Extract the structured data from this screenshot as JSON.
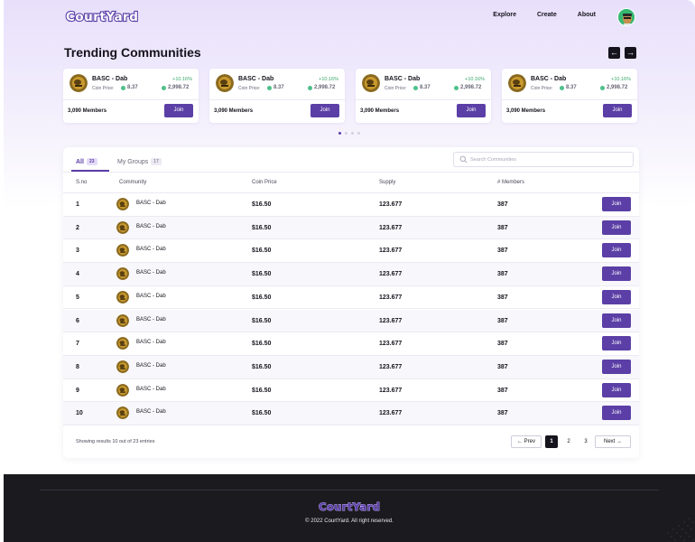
{
  "brand": {
    "logo_text": "CourtYard",
    "accent": "#5b3fa6"
  },
  "nav": {
    "links": [
      "Explore",
      "Create",
      "About"
    ]
  },
  "trending": {
    "title": "Trending Communities",
    "prev_icon": "←",
    "next_icon": "→",
    "cards": [
      {
        "name": "BASC - Dab",
        "change": "+10.16%",
        "price_label": "Coin Price:",
        "price": "8.37",
        "supply": "2,998.72",
        "members": "3,090 Members",
        "join": "Join"
      },
      {
        "name": "BASC - Dab",
        "change": "+10.16%",
        "price_label": "Coin Price:",
        "price": "8.37",
        "supply": "2,998.72",
        "members": "3,090 Members",
        "join": "Join"
      },
      {
        "name": "BASC - Dab",
        "change": "+10.16%",
        "price_label": "Coin Price:",
        "price": "8.37",
        "supply": "2,998.72",
        "members": "3,090 Members",
        "join": "Join"
      },
      {
        "name": "BASC - Dab",
        "change": "+10.16%",
        "price_label": "Coin Price:",
        "price": "8.37",
        "supply": "2,998.72",
        "members": "3,090 Members",
        "join": "Join"
      }
    ]
  },
  "tabs": [
    {
      "label": "All",
      "count": "23"
    },
    {
      "label": "My Groups",
      "count": "17"
    }
  ],
  "search": {
    "placeholder": "Search Communities"
  },
  "table": {
    "headers": [
      "S.no",
      "Community",
      "Coin Price",
      "Supply",
      "# Members"
    ],
    "rows": [
      {
        "sno": "1",
        "community": "BASC - Dab",
        "price": "$16.50",
        "supply": "123.677",
        "members": "387",
        "join": "Join"
      },
      {
        "sno": "2",
        "community": "BASC - Dab",
        "price": "$16.50",
        "supply": "123.677",
        "members": "387",
        "join": "Join"
      },
      {
        "sno": "3",
        "community": "BASC - Dab",
        "price": "$16.50",
        "supply": "123.677",
        "members": "387",
        "join": "Join"
      },
      {
        "sno": "4",
        "community": "BASC - Dab",
        "price": "$16.50",
        "supply": "123.677",
        "members": "387",
        "join": "Join"
      },
      {
        "sno": "5",
        "community": "BASC - Dab",
        "price": "$16.50",
        "supply": "123.677",
        "members": "387",
        "join": "Join"
      },
      {
        "sno": "6",
        "community": "BASC - Dab",
        "price": "$16.50",
        "supply": "123.677",
        "members": "387",
        "join": "Join"
      },
      {
        "sno": "7",
        "community": "BASC - Dab",
        "price": "$16.50",
        "supply": "123.677",
        "members": "387",
        "join": "Join"
      },
      {
        "sno": "8",
        "community": "BASC - Dab",
        "price": "$16.50",
        "supply": "123.677",
        "members": "387",
        "join": "Join"
      },
      {
        "sno": "9",
        "community": "BASC - Dab",
        "price": "$16.50",
        "supply": "123.677",
        "members": "387",
        "join": "Join"
      },
      {
        "sno": "10",
        "community": "BASC - Dab",
        "price": "$16.50",
        "supply": "123.677",
        "members": "387",
        "join": "Join"
      }
    ]
  },
  "pagination": {
    "summary": "Showing results 10 out of 23 entries",
    "prev": "← Prev",
    "next": "Next →",
    "pages": [
      "1",
      "2",
      "3"
    ],
    "current": "1"
  },
  "footer": {
    "copyright": "© 2022 CourtYard. All right reserved."
  }
}
